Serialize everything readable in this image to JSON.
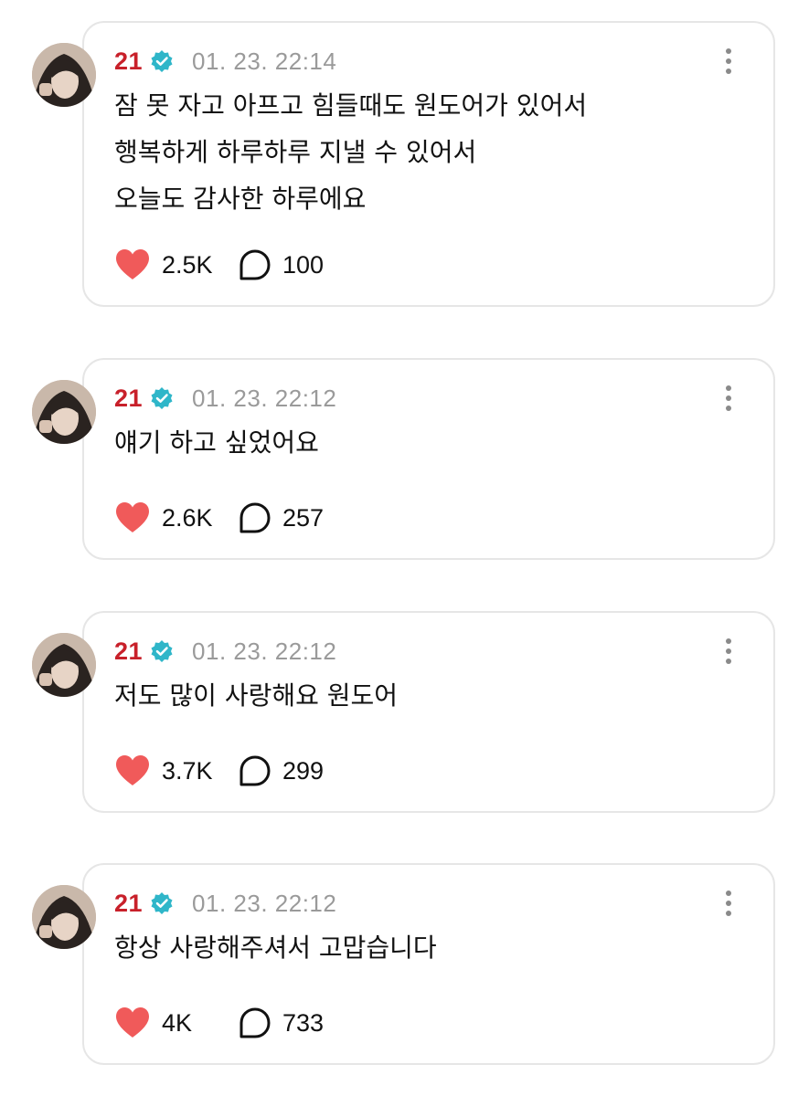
{
  "colors": {
    "author": "#c8202a",
    "verified": "#2fb6c9",
    "timestamp": "#9a9a9a",
    "heart": "#f05a5a",
    "border": "#e6e6e6"
  },
  "posts": [
    {
      "author": "21",
      "verified_icon": "verified-badge-icon",
      "timestamp": "01. 23. 22:14",
      "lines": [
        "잠 못 자고 아프고 힘들때도 원도어가 있어서",
        "행복하게 하루하루 지낼 수 있어서",
        "오늘도 감사한 하루에요"
      ],
      "likes": "2.5K",
      "comments": "100"
    },
    {
      "author": "21",
      "verified_icon": "verified-badge-icon",
      "timestamp": "01. 23. 22:12",
      "lines": [
        "얘기 하고 싶었어요"
      ],
      "likes": "2.6K",
      "comments": "257"
    },
    {
      "author": "21",
      "verified_icon": "verified-badge-icon",
      "timestamp": "01. 23. 22:12",
      "lines": [
        "저도 많이 사랑해요 원도어"
      ],
      "likes": "3.7K",
      "comments": "299"
    },
    {
      "author": "21",
      "verified_icon": "verified-badge-icon",
      "timestamp": "01. 23. 22:12",
      "lines": [
        "항상 사랑해주셔서 고맙습니다"
      ],
      "likes": "4K",
      "comments": "733"
    }
  ]
}
